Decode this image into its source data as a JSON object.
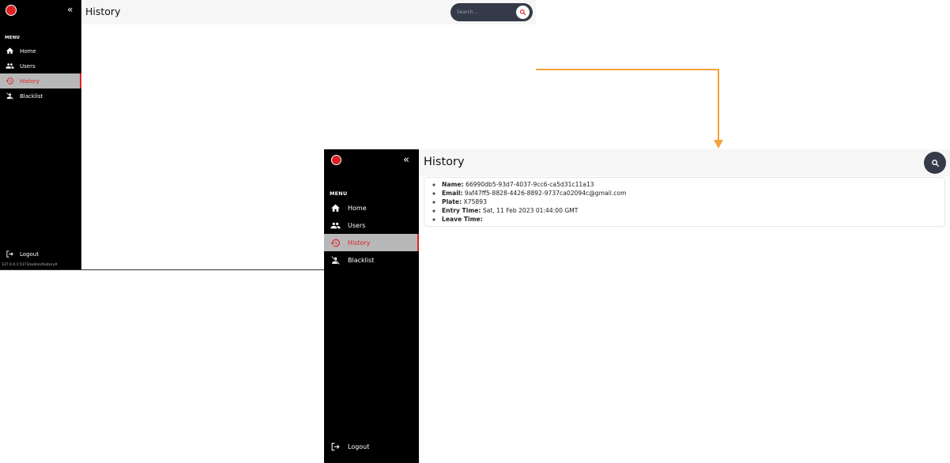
{
  "colors": {
    "sidebar_bg": "#000000",
    "active_item_bg": "#b8b8b8",
    "active_accent": "#e02020",
    "topbar_bg": "#f6f6f7",
    "search_bg": "#343a48",
    "arrow": "#f2a33a"
  },
  "screen_before": {
    "sidebar": {
      "collapse_icon": "double-chevron-left-icon",
      "menu_label": "MENU",
      "items": [
        {
          "label": "Home",
          "icon": "home-icon",
          "active": false
        },
        {
          "label": "Users",
          "icon": "users-icon",
          "active": false
        },
        {
          "label": "History",
          "icon": "history-icon",
          "active": true
        },
        {
          "label": "Blacklist",
          "icon": "blacklist-icon",
          "active": false
        }
      ],
      "logout_label": "Logout",
      "status_url": "127.0.0.1:5173/admin/history#"
    },
    "header": {
      "title": "History",
      "search_placeholder": "Search..."
    }
  },
  "screen_after": {
    "sidebar": {
      "collapse_icon": "double-chevron-left-icon",
      "menu_label": "MENU",
      "items": [
        {
          "label": "Home",
          "icon": "home-icon",
          "active": false
        },
        {
          "label": "Users",
          "icon": "users-icon",
          "active": false
        },
        {
          "label": "History",
          "icon": "history-icon",
          "active": true
        },
        {
          "label": "Blacklist",
          "icon": "blacklist-icon",
          "active": false
        }
      ],
      "logout_label": "Logout"
    },
    "header": {
      "title": "History"
    },
    "record": {
      "name_label": "Name:",
      "name_value": "66990db5-93d7-4037-9cc6-ca5d31c11a13",
      "email_label": "Email:",
      "email_value": "9af47ff5-8828-4426-8892-9737ca02094c@gmail.com",
      "plate_label": "Plate:",
      "plate_value": "X75893",
      "entry_label": "Entry Time:",
      "entry_value": "Sat, 11 Feb 2023 01:44:00 GMT",
      "leave_label": "Leave Time:",
      "leave_value": ""
    }
  }
}
